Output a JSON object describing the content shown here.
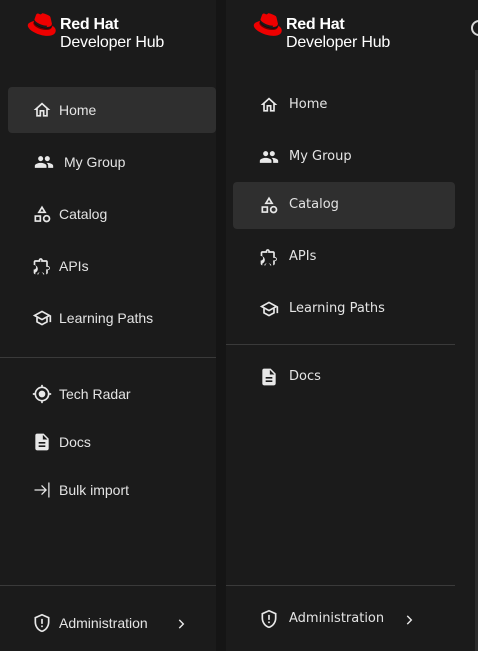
{
  "logo": {
    "brand": "Red Hat",
    "product": "Developer Hub"
  },
  "colors": {
    "brand_red": "#EE0000",
    "active_bg": "#2f2f2f",
    "sidebar_bg": "#1b1b1b"
  },
  "left_sidebar": {
    "items": [
      {
        "label": "Home",
        "icon": "home-icon",
        "active": true
      },
      {
        "label": "My Group",
        "icon": "group-icon",
        "active": false
      },
      {
        "label": "Catalog",
        "icon": "catalog-icon",
        "active": false
      },
      {
        "label": "APIs",
        "icon": "puzzle-icon",
        "active": false
      },
      {
        "label": "Learning Paths",
        "icon": "school-icon",
        "active": false
      }
    ],
    "secondary_items": [
      {
        "label": "Tech Radar",
        "icon": "radar-icon"
      },
      {
        "label": "Docs",
        "icon": "docs-icon"
      },
      {
        "label": "Bulk import",
        "icon": "login-icon"
      }
    ],
    "footer": {
      "label": "Administration",
      "icon": "shield-icon"
    }
  },
  "right_sidebar": {
    "items": [
      {
        "label": "Home",
        "icon": "home-icon",
        "active": false
      },
      {
        "label": "My Group",
        "icon": "group-icon",
        "active": false
      },
      {
        "label": "Catalog",
        "icon": "catalog-icon",
        "active": true
      },
      {
        "label": "APIs",
        "icon": "puzzle-icon",
        "active": false
      },
      {
        "label": "Learning Paths",
        "icon": "school-icon",
        "active": false
      }
    ],
    "secondary_items": [
      {
        "label": "Docs",
        "icon": "docs-icon"
      }
    ],
    "footer": {
      "label": "Administration",
      "icon": "shield-icon"
    }
  }
}
